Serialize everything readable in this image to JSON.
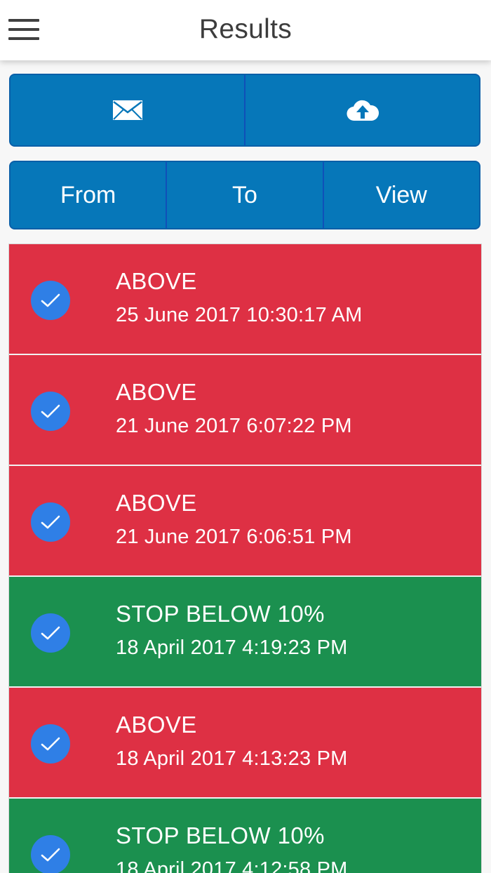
{
  "header": {
    "title": "Results",
    "menu_icon": "hamburger-menu-icon"
  },
  "actions": [
    {
      "name": "email",
      "icon": "envelope-icon"
    },
    {
      "name": "upload",
      "icon": "cloud-upload-icon"
    }
  ],
  "filters": {
    "from_label": "From",
    "to_label": "To",
    "view_label": "View"
  },
  "colors": {
    "accent": "#0677b9",
    "above": "#de3044",
    "stop_below": "#1b904f",
    "check": "#2f7fe6"
  },
  "results": [
    {
      "status": "ABOVE",
      "date": "25 June 2017 10:30:17 AM",
      "color": "red"
    },
    {
      "status": "ABOVE",
      "date": "21 June 2017 6:07:22 PM",
      "color": "red"
    },
    {
      "status": "ABOVE",
      "date": "21 June 2017 6:06:51 PM",
      "color": "red"
    },
    {
      "status": "STOP BELOW 10%",
      "date": "18 April 2017 4:19:23 PM",
      "color": "green"
    },
    {
      "status": "ABOVE",
      "date": "18 April 2017 4:13:23 PM",
      "color": "red"
    },
    {
      "status": "STOP BELOW 10%",
      "date": "18 April 2017 4:12:58 PM",
      "color": "green"
    }
  ]
}
